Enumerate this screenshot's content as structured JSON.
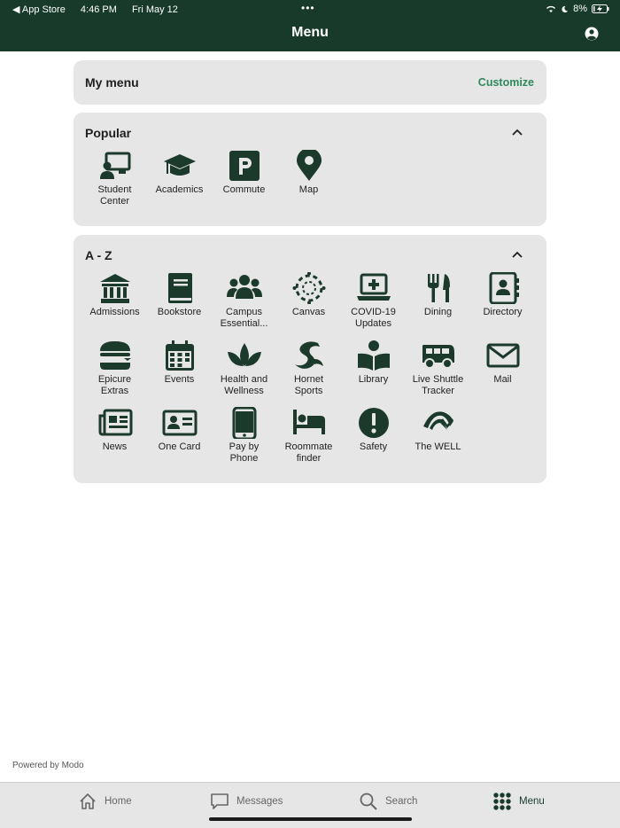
{
  "status_bar": {
    "back_app": "◀ App Store",
    "time": "4:46 PM",
    "date": "Fri May 12",
    "battery": "8%"
  },
  "header": {
    "title": "Menu"
  },
  "my_menu": {
    "title": "My menu",
    "customize": "Customize"
  },
  "popular": {
    "title": "Popular",
    "items": [
      {
        "label": "Student\nCenter",
        "icon": "student-center-icon"
      },
      {
        "label": "Academics",
        "icon": "graduation-cap-icon"
      },
      {
        "label": "Commute",
        "icon": "parking-icon"
      },
      {
        "label": "Map",
        "icon": "map-pin-icon"
      }
    ]
  },
  "az": {
    "title": "A - Z",
    "items": [
      {
        "label": "Admissions",
        "icon": "building-icon"
      },
      {
        "label": "Bookstore",
        "icon": "book-icon"
      },
      {
        "label": "Campus\nEssential...",
        "icon": "people-icon"
      },
      {
        "label": "Canvas",
        "icon": "canvas-icon"
      },
      {
        "label": "COVID-19\nUpdates",
        "icon": "laptop-medical-icon"
      },
      {
        "label": "Dining",
        "icon": "utensils-icon"
      },
      {
        "label": "Directory",
        "icon": "address-book-icon"
      },
      {
        "label": "Epicure\nExtras",
        "icon": "burger-icon"
      },
      {
        "label": "Events",
        "icon": "calendar-icon"
      },
      {
        "label": "Health and\nWellness",
        "icon": "lotus-icon"
      },
      {
        "label": "Hornet\nSports",
        "icon": "hornet-logo-icon"
      },
      {
        "label": "Library",
        "icon": "reader-icon"
      },
      {
        "label": "Live Shuttle\nTracker",
        "icon": "bus-icon"
      },
      {
        "label": "Mail",
        "icon": "envelope-icon"
      },
      {
        "label": "News",
        "icon": "newspaper-icon"
      },
      {
        "label": "One Card",
        "icon": "id-card-icon"
      },
      {
        "label": "Pay by\nPhone",
        "icon": "phone-icon"
      },
      {
        "label": "Roommate\nfinder",
        "icon": "bed-icon"
      },
      {
        "label": "Safety",
        "icon": "exclamation-icon"
      },
      {
        "label": "The WELL",
        "icon": "well-logo-icon"
      }
    ]
  },
  "footer": {
    "powered": "Powered by Modo"
  },
  "tabbar": {
    "home": "Home",
    "messages": "Messages",
    "search": "Search",
    "menu": "Menu"
  },
  "colors": {
    "header": "#173a2a",
    "accent": "#2e8a5e",
    "icon": "#1b3a2b",
    "card": "#e6e6e6"
  }
}
